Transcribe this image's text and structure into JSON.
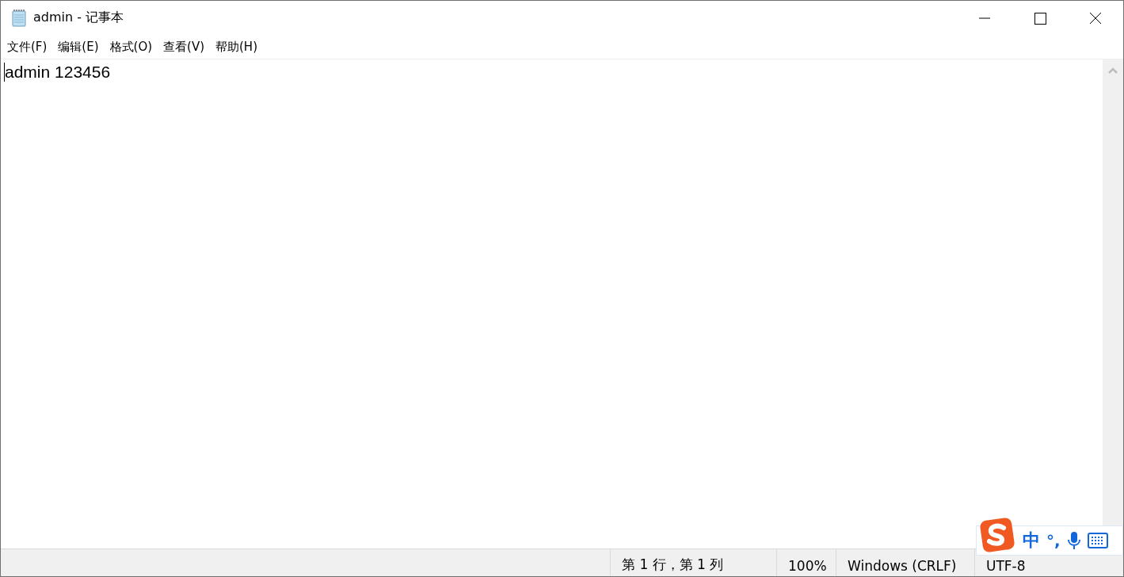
{
  "window": {
    "title": "admin - 记事本"
  },
  "menu": [
    {
      "label": "文件(F)"
    },
    {
      "label": "编辑(E)"
    },
    {
      "label": "格式(O)"
    },
    {
      "label": "查看(V)"
    },
    {
      "label": "帮助(H)"
    }
  ],
  "editor": {
    "value": "admin 123456"
  },
  "status_bar": [
    {
      "text": "第 1 行，第 1 列"
    },
    {
      "text": "100%"
    },
    {
      "text": "Windows (CRLF)"
    },
    {
      "text": "UTF-8"
    }
  ],
  "ime_toolbar": {
    "mode": "中",
    "punctuation": "°,"
  }
}
